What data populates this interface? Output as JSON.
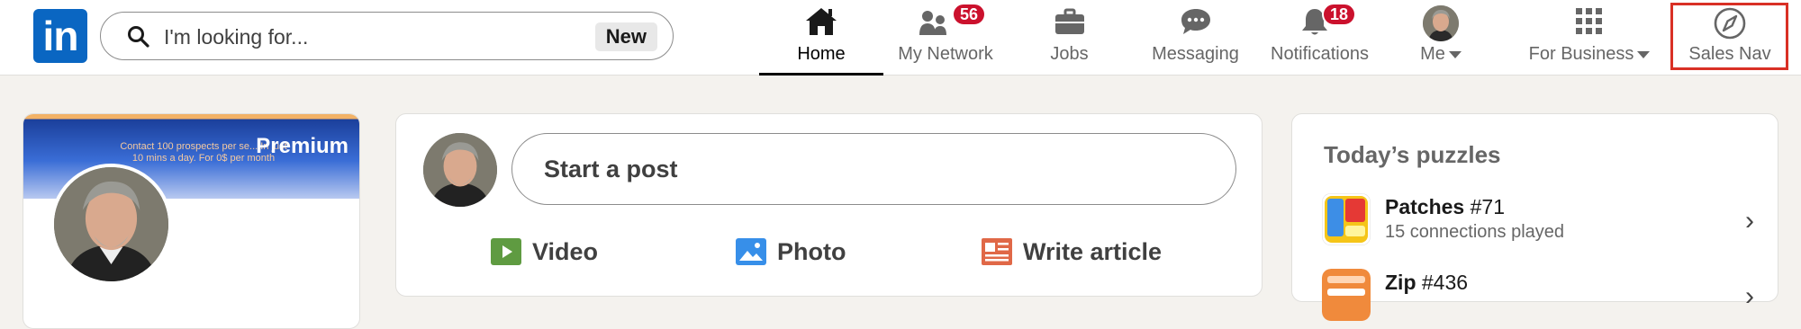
{
  "nav": {
    "search_placeholder": "I'm looking for...",
    "search_badge": "New",
    "items": [
      {
        "label": "Home",
        "icon": "home-icon",
        "active": true
      },
      {
        "label": "My Network",
        "icon": "network-icon",
        "badge": "56"
      },
      {
        "label": "Jobs",
        "icon": "briefcase-icon"
      },
      {
        "label": "Messaging",
        "icon": "chat-icon"
      },
      {
        "label": "Notifications",
        "icon": "bell-icon",
        "badge": "18"
      },
      {
        "label": "Me",
        "icon": "avatar"
      },
      {
        "label": "For Business",
        "icon": "grid-icon"
      },
      {
        "label": "Sales Nav",
        "icon": "compass-icon"
      }
    ]
  },
  "profile": {
    "banner_text": "Contact 100 prospects per se... In just 10 mins a day. For 0$ per month",
    "premium_label": "Premium"
  },
  "post": {
    "placeholder": "Start a post",
    "actions": [
      {
        "label": "Video",
        "icon": "video-icon",
        "color": "#5f9b41"
      },
      {
        "label": "Photo",
        "icon": "photo-icon",
        "color": "#378fe9"
      },
      {
        "label": "Write article",
        "icon": "article-icon",
        "color": "#e06847"
      }
    ]
  },
  "puzzles": {
    "title": "Today’s puzzles",
    "items": [
      {
        "name": "Patches",
        "number": "#71",
        "sub": "15 connections played"
      },
      {
        "name": "Zip",
        "number": "#436",
        "sub": ""
      }
    ]
  },
  "colors": {
    "brand": "#0a66c2",
    "badge": "#cb112d",
    "highlight": "#d93025"
  }
}
